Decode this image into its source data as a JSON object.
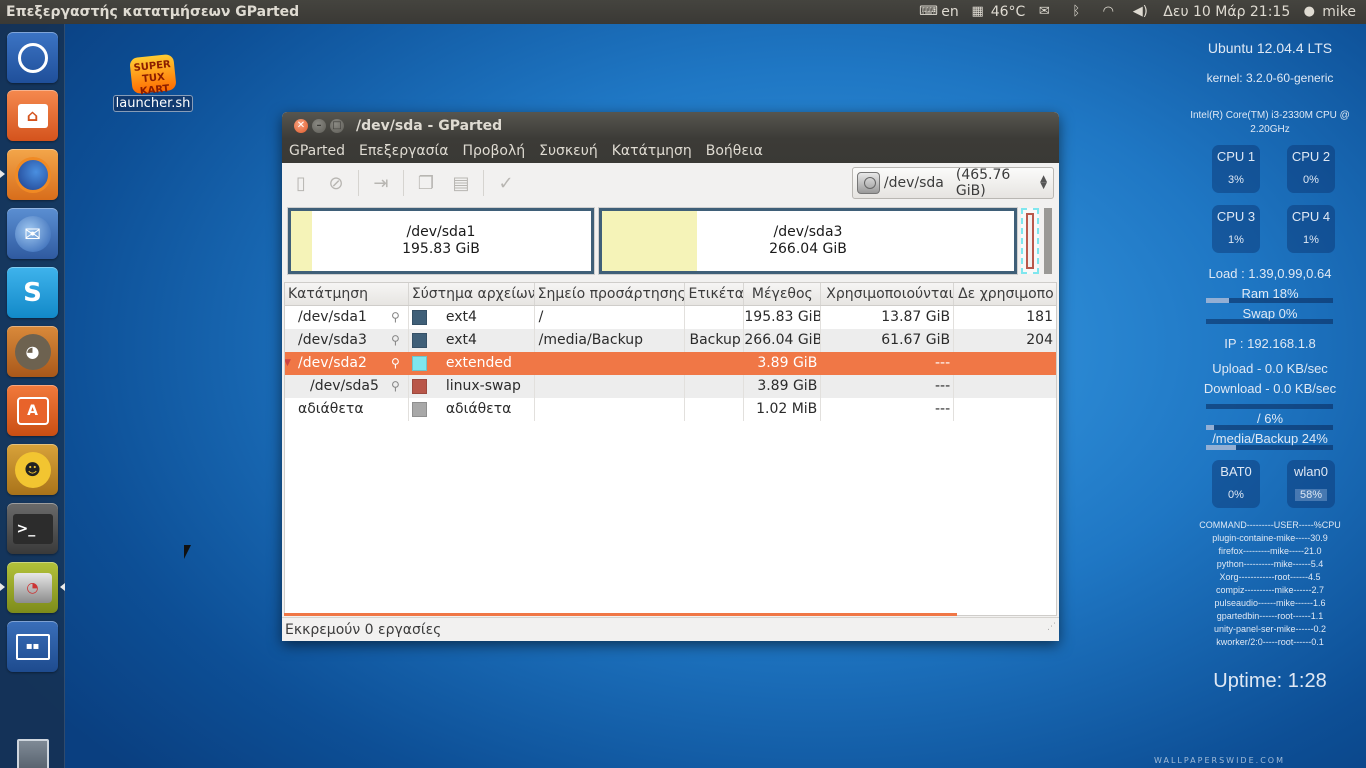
{
  "top_panel": {
    "app_title": "Επεξεργαστής κατατμήσεων GParted",
    "keyboard_layout": "en",
    "temperature": "46°C",
    "datetime": "Δευ 10 Μάρ 21:15",
    "user": "mike"
  },
  "desktop": {
    "icon_label": "launcher.sh",
    "icon_logo_text": "SUPER TUX KART",
    "watermark": "WALLPAPERSWIDE.COM"
  },
  "window": {
    "title": "/dev/sda - GParted",
    "menu": [
      "GParted",
      "Επεξεργασία",
      "Προβολή",
      "Συσκευή",
      "Κατάτμηση",
      "Βοήθεια"
    ],
    "device_selector": {
      "device": "/dev/sda",
      "size": "(465.76 GiB)"
    },
    "partition_map": [
      {
        "name": "/dev/sda1",
        "size": "195.83 GiB",
        "used_fraction": 0.07
      },
      {
        "name": "/dev/sda3",
        "size": "266.04 GiB",
        "used_fraction": 0.23
      }
    ],
    "table": {
      "headers": [
        "Κατάτμηση",
        "Σύστημα αρχείων",
        "Σημείο προσάρτησης",
        "Ετικέτα",
        "Μέγεθος",
        "Χρησιμοποιούνται",
        "Δε χρησιμοπο"
      ],
      "rows": [
        {
          "partition": "/dev/sda1",
          "fs": "ext4",
          "fs_color": "#3f5f78",
          "mount": "/",
          "label": "",
          "size": "195.83 GiB",
          "used": "13.87 GiB",
          "unused": "181"
        },
        {
          "partition": "/dev/sda3",
          "fs": "ext4",
          "fs_color": "#3f5f78",
          "mount": "/media/Backup",
          "label": "Backup",
          "size": "266.04 GiB",
          "used": "61.67 GiB",
          "unused": "204"
        },
        {
          "partition": "/dev/sda2",
          "fs": "extended",
          "fs_color": "#7fe6ee",
          "mount": "",
          "label": "",
          "size": "3.89 GiB",
          "used": "---",
          "unused": ""
        },
        {
          "partition": "/dev/sda5",
          "fs": "linux-swap",
          "fs_color": "#b9574a",
          "mount": "",
          "label": "",
          "size": "3.89 GiB",
          "used": "---",
          "unused": ""
        },
        {
          "partition": "αδιάθετα",
          "fs": "αδιάθετα",
          "fs_color": "#a8a8a8",
          "mount": "",
          "label": "",
          "size": "1.02 MiB",
          "used": "---",
          "unused": ""
        }
      ]
    },
    "status": "Εκκρεμούν 0 εργασίες"
  },
  "conky": {
    "distro": "Ubuntu 12.04.4 LTS",
    "kernel": "kernel: 3.2.0-60-generic",
    "cpu_model_1": "Intel(R) Core(TM) i3-2330M CPU @",
    "cpu_model_2": "2.20GHz",
    "cpus": [
      {
        "label": "CPU 1",
        "value": "3%"
      },
      {
        "label": "CPU 2",
        "value": "0%"
      },
      {
        "label": "CPU 3",
        "value": "1%"
      },
      {
        "label": "CPU 4",
        "value": "1%"
      }
    ],
    "load": "Load : 1.39,0.99,0.64",
    "ram": "Ram 18%",
    "ram_fraction": 0.18,
    "swap": "Swap 0%",
    "swap_fraction": 0.0,
    "ip": "IP : 192.168.1.8",
    "upload": "Upload - 0.0 KB/sec",
    "download": "Download - 0.0 KB/sec",
    "root_disk": "/ 6%",
    "root_fraction": 0.06,
    "backup_disk": "/media/Backup 24%",
    "backup_fraction": 0.24,
    "bat": {
      "label": "BAT0",
      "value": "0%"
    },
    "wlan": {
      "label": "wlan0",
      "value": "58%"
    },
    "processes": [
      "COMMAND---------USER-----%CPU",
      "plugin-containe-mike-----30.9",
      "firefox---------mike-----21.0",
      "python----------mike------5.4",
      "Xorg------------root------4.5",
      "compiz----------mike------2.7",
      "pulseaudio------mike------1.6",
      "gpartedbin------root------1.1",
      "unity-panel-ser-mike------0.2",
      "kworker/2:0-----root------0.1"
    ],
    "uptime": "Uptime: 1:28"
  }
}
